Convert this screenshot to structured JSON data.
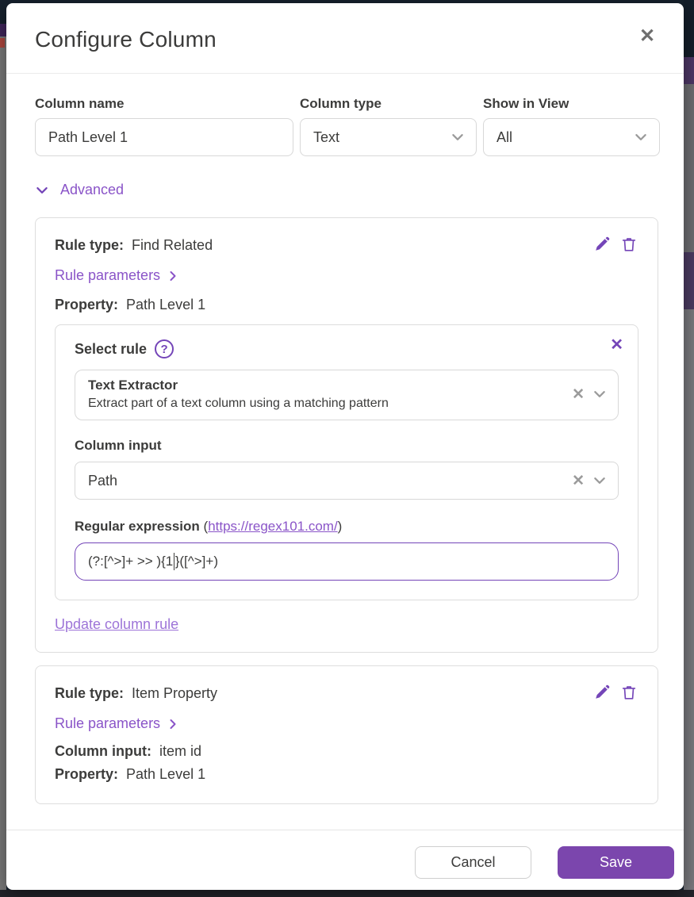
{
  "modal": {
    "title": "Configure Column",
    "close_icon": "✕"
  },
  "fields": {
    "column_name": {
      "label": "Column name",
      "value": "Path Level 1"
    },
    "column_type": {
      "label": "Column type",
      "value": "Text"
    },
    "show_in_view": {
      "label": "Show in View",
      "value": "All"
    }
  },
  "advanced_label": "Advanced",
  "rule1": {
    "rule_type_label": "Rule type:",
    "rule_type_value": "Find Related",
    "parameters_label": "Rule parameters",
    "property_label": "Property:",
    "property_value": "Path Level 1"
  },
  "editor": {
    "select_rule_label": "Select rule",
    "help_icon": "?",
    "close_icon": "✕",
    "rule_title": "Text Extractor",
    "rule_description": "Extract part of a text column using a matching pattern",
    "clear_icon": "✕",
    "column_input_label": "Column input",
    "column_input_value": "Path",
    "regex_label": "Regular expression",
    "regex_paren_open": "(",
    "regex_link": "https://regex101.com/",
    "regex_paren_close": ")",
    "regex_value_before_caret": "(?:[^>]+ >> ){1",
    "regex_value_after_caret": "}([^>]+)",
    "update_link": "Update column rule"
  },
  "rule2": {
    "rule_type_label": "Rule type:",
    "rule_type_value": "Item Property",
    "parameters_label": "Rule parameters",
    "column_input_label": "Column input:",
    "column_input_value": "item id",
    "property_label": "Property:",
    "property_value": "Path Level 1"
  },
  "footer": {
    "cancel_label": "Cancel",
    "save_label": "Save"
  },
  "colors": {
    "accent_purple": "#7b46ad",
    "link_purple": "#8a54c8",
    "light_link_purple": "#9d74d8",
    "icon_purple": "#7445b8",
    "grey_icon": "#9b9b9b",
    "backdrop_navy": "#16212d",
    "backdrop_grey": "#7b7b7b"
  }
}
